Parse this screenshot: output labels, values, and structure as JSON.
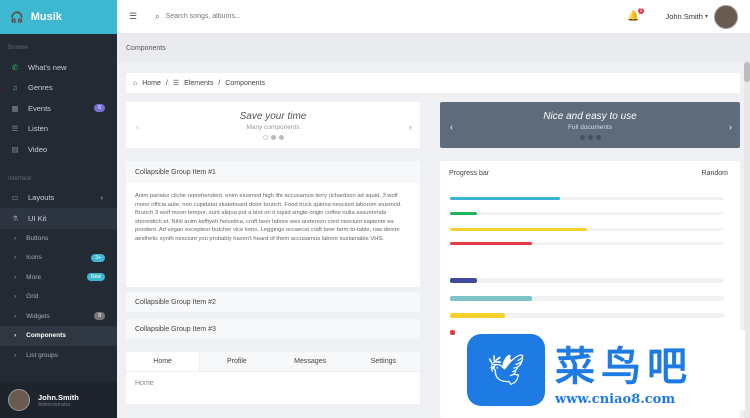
{
  "brand": "Musik",
  "sidebar": {
    "section1": "Browse",
    "items": [
      {
        "label": "What's new"
      },
      {
        "label": "Genres"
      },
      {
        "label": "Events",
        "badge": "6"
      },
      {
        "label": "Listen"
      },
      {
        "label": "Video"
      }
    ],
    "section2": "Interface",
    "items2": [
      {
        "label": "Layouts"
      },
      {
        "label": "UI Kit"
      }
    ],
    "sub": [
      {
        "label": "Buttons"
      },
      {
        "label": "Icons",
        "badge": "3+"
      },
      {
        "label": "More",
        "badge": "New"
      },
      {
        "label": "Grid"
      },
      {
        "label": "Widgets",
        "badge": "8"
      },
      {
        "label": "Components"
      },
      {
        "label": "List groups"
      }
    ],
    "user": {
      "name": "John.Smith",
      "role": "Administrator"
    }
  },
  "topbar": {
    "search_placeholder": "Search songs, albums...",
    "notif": "2",
    "user": "John.Smith"
  },
  "page_title": "Components",
  "breadcrumb": [
    "Home",
    "Elements",
    "Components"
  ],
  "carousel1": {
    "title": "Save your time",
    "subtitle": "Many components"
  },
  "carousel2": {
    "title": "Nice and easy to use",
    "subtitle": "Full documents"
  },
  "collapse": {
    "item1": "Collapsible Group Item #1",
    "body": "Anim pariatur cliche reprehenderit, enim eiusmod high life accusamus terry richardson ad squid. 3 wolf moon officia aute, non cupidatat skateboard dolor brunch. Food truck quinoa nesciunt laborum eiusmod. Brunch 3 wolf moon tempor, sunt aliqua put a bird on it squid single-origin coffee nulla assumenda shoreditch et. Nihil anim keffiyeh helvetica, craft beer labore wes anderson cred nesciunt sapiente ea proident. Ad vegan excepteur butcher vice lomo. Leggings occaecat craft beer farm-to-table, raw denim aesthetic synth nesciunt you probably haven't heard of them accusamus labore sustainable VHS.",
    "item2": "Collapsible Group Item #2",
    "item3": "Collapsible Group Item #3"
  },
  "tabs": [
    "Home",
    "Profile",
    "Messages",
    "Settings"
  ],
  "tab_content": "Home",
  "progress": {
    "title": "Progress bar",
    "action": "Random",
    "bars": [
      {
        "value": 40,
        "color": "#3bb4d4"
      },
      {
        "value": 10,
        "color": "#22b35e"
      },
      {
        "value": 50,
        "color": "#f7d12a"
      },
      {
        "value": 30,
        "color": "#e53945"
      },
      {
        "value": 10,
        "color": "#3f4c9e"
      },
      {
        "value": 30,
        "color": "#7cc4c8"
      },
      {
        "value": 20,
        "color": "#f7d12a"
      },
      {
        "value": 2,
        "color": "#e53945"
      }
    ]
  },
  "watermark": {
    "cn": "菜鸟吧",
    "url": "www.cniao8.com"
  }
}
